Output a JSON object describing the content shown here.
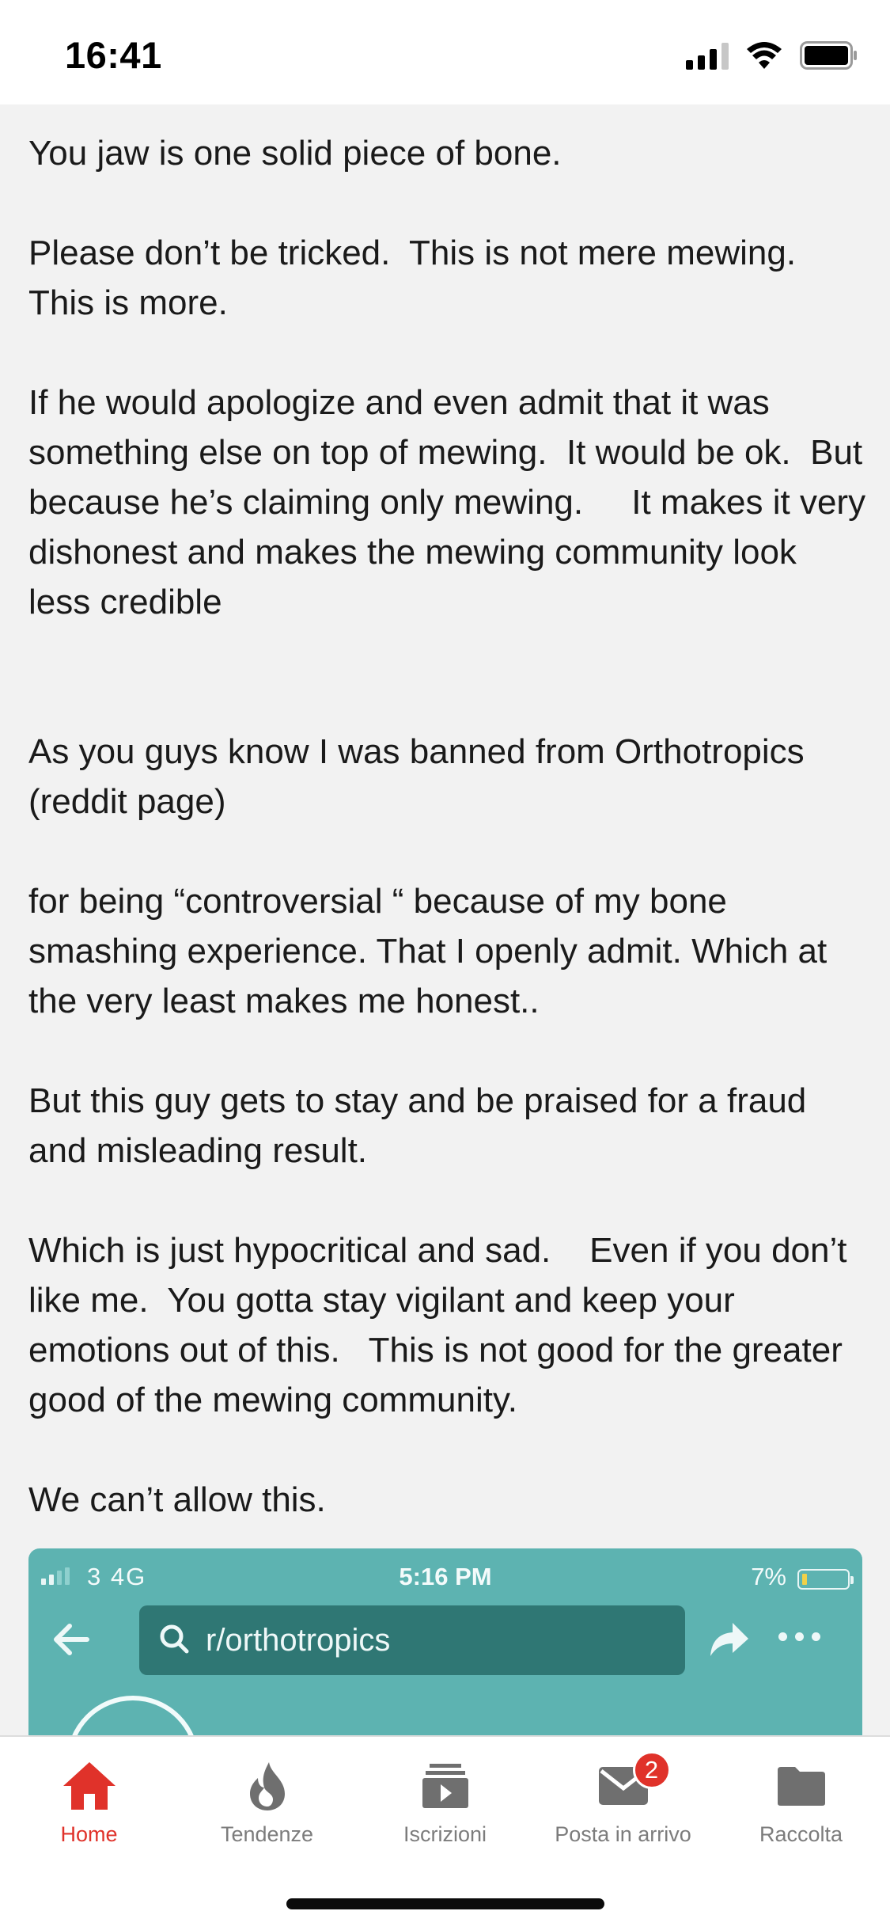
{
  "status_bar": {
    "time": "16:41"
  },
  "post": {
    "paragraphs": [
      "You jaw is one solid piece of bone.",
      "Please don’t be tricked.  This is not mere mewing.  This is more.",
      "If he would apologize and even admit that it was something else on top of mewing.  It would be ok.  But because he’s claiming only mewing.     It makes it very dishonest and makes the mewing community look less credible",
      "As you guys know I was banned from Orthotropics (reddit page)",
      "for being “controversial “ because of my bone smashing experience. That I openly admit. Which at the very least makes me honest..",
      "But this guy gets to stay and be praised for a fraud and misleading result.",
      "Which is just hypocritical and sad.    Even if you don’t like me.  You gotta stay vigilant and keep your emotions out of this.   This is not good for the greater good of the mewing community.",
      "We can’t allow this."
    ]
  },
  "embedded_screenshot": {
    "carrier": "3  4G",
    "time": "5:16 PM",
    "battery": "7%",
    "search_text": "r/orthotropics",
    "background_color": "#5db3b1"
  },
  "tab_bar": {
    "tabs": [
      {
        "label": "Home",
        "icon": "home-icon",
        "active": true
      },
      {
        "label": "Tendenze",
        "icon": "flame-icon",
        "active": false
      },
      {
        "label": "Iscrizioni",
        "icon": "subscriptions-icon",
        "active": false
      },
      {
        "label": "Posta in arrivo",
        "icon": "mail-icon",
        "active": false,
        "badge": "2"
      },
      {
        "label": "Raccolta",
        "icon": "folder-icon",
        "active": false
      }
    ],
    "active_color": "#e0322a",
    "inactive_color": "#7c7c7c"
  }
}
